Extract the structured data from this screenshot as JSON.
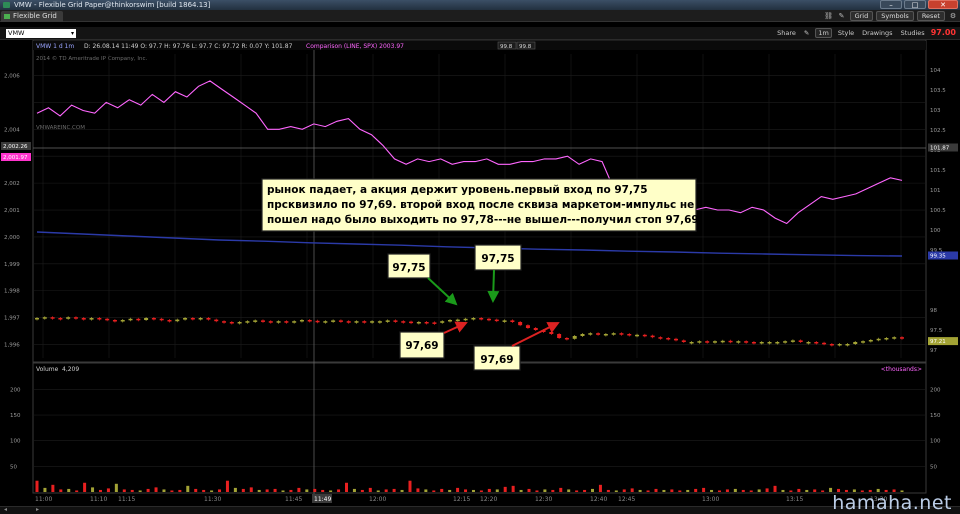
{
  "window": {
    "title": "VMW - Flexible Grid Paper@thinkorswim [build 1864.13]",
    "buttons": [
      "–",
      "□",
      "✕"
    ]
  },
  "tabbar": {
    "tab_label": "Flexible Grid",
    "grid_label": "Grid",
    "symbols_label": "Symbols",
    "reset_label": "Reset"
  },
  "chart_toolbar": {
    "symbol": "VMW",
    "share_label": "Share",
    "aggregation_label": "1m",
    "style_label": "Style",
    "drawings_label": "Drawings",
    "studies_label": "Studies",
    "last_price": "97.00"
  },
  "price_panel": {
    "header": {
      "symbol_tf": "VMW 1 d 1m",
      "ohlc": "D: 26.08.14 11:49  O: 97.7  H: 97.76  L: 97.7  C: 97.72  R: 0.07  Y: 101.87",
      "comparison": "Comparison (LINE, SPX)  2003.97",
      "box1": "99.8",
      "box2": "99.8"
    },
    "copyright": "2014 © TD Ameritrade IP Company, Inc.",
    "description": "VMWAREINC.COM",
    "left_axis_ticks": [
      "2,006",
      "2,004",
      "2,003",
      "2,002",
      "2,001",
      "2,000",
      "1,999",
      "1,998",
      "1,997",
      "1,996"
    ],
    "left_axis_badges": [
      "2,002.26",
      "2,001.97"
    ],
    "right_axis_ticks": [
      "104",
      "103.5",
      "103",
      "102.5",
      "102",
      "101.5",
      "101",
      "100.5",
      "100",
      "99.5",
      "98",
      "97.5",
      "97"
    ],
    "right_axis_badges": [
      "101.87",
      "99.35",
      "97.21"
    ]
  },
  "volume_panel": {
    "label": "Volume",
    "value": "4,209",
    "unit": "<thousands>",
    "left_axis_ticks": [
      "200",
      "150",
      "100",
      "50"
    ],
    "right_axis_ticks": [
      "200",
      "150",
      "100",
      "50"
    ]
  },
  "time_axis": {
    "labels": [
      "11:00",
      "11:10",
      "11:15",
      "11:30",
      "11:45",
      "12:00",
      "12:15",
      "12:20",
      "12:30",
      "12:40",
      "12:45",
      "13:00",
      "13:15",
      "13:30"
    ],
    "cursor_label": "11:49"
  },
  "annotations": {
    "note": "рынок падает, а акция держит уровень.первый вход по 97,75 прсквизило по 97,69. второй вход после сквиза маркетом-импульс не пошел надо было выходить по 97,78---не вышел---получил стоп 97,69",
    "note_lines": [
      "рынок падает, а акция держит уровень.первый вход по 97,75",
      "прсквизило по 97,69. второй вход после сквиза маркетом-импульс не",
      "пошел надо было выходить по 97,78---не вышел---получил стоп 97,69"
    ],
    "labels": [
      "97,75",
      "97,75",
      "97,69",
      "97,69"
    ]
  },
  "colors": {
    "comparison_line": "#ff66ff",
    "moving_average": "#2b3aa8",
    "candle_up": "#a3a335",
    "candle_down": "#e82020",
    "note_background": "#ffffc8",
    "arrow_green": "#1a9a1a",
    "arrow_red": "#dd2222"
  },
  "watermark": "hamaha.net",
  "chart_data": [
    {
      "type": "line",
      "name_ref": "price_panel.header.comparison",
      "y_axis": "left",
      "ylim": [
        1995.5,
        2006.8
      ],
      "x": [
        "11:00",
        "11:02",
        "11:04",
        "11:06",
        "11:08",
        "11:10",
        "11:12",
        "11:14",
        "11:16",
        "11:18",
        "11:20",
        "11:22",
        "11:24",
        "11:26",
        "11:28",
        "11:30",
        "11:32",
        "11:34",
        "11:36",
        "11:38",
        "11:40",
        "11:42",
        "11:44",
        "11:46",
        "11:48",
        "11:50",
        "11:52",
        "11:54",
        "11:56",
        "11:58",
        "12:00",
        "12:02",
        "12:04",
        "12:06",
        "12:08",
        "12:10",
        "12:12",
        "12:14",
        "12:16",
        "12:18",
        "12:20",
        "12:22",
        "12:24",
        "12:26",
        "12:28",
        "12:30",
        "12:32",
        "12:34",
        "12:36",
        "12:38",
        "12:40",
        "12:42",
        "12:44",
        "12:46",
        "12:48",
        "12:50",
        "12:52",
        "12:54",
        "12:56",
        "12:58",
        "13:00",
        "13:02",
        "13:04",
        "13:06",
        "13:08",
        "13:10",
        "13:12",
        "13:14",
        "13:16",
        "13:18",
        "13:20",
        "13:22",
        "13:24",
        "13:26",
        "13:28",
        "13:30"
      ],
      "values": [
        2004.6,
        2004.8,
        2004.5,
        2004.9,
        2004.7,
        2004.6,
        2005.0,
        2004.8,
        2005.1,
        2004.9,
        2005.3,
        2005.0,
        2005.4,
        2005.2,
        2005.6,
        2005.8,
        2005.5,
        2005.2,
        2004.9,
        2004.6,
        2004.0,
        2004.0,
        2004.1,
        2004.0,
        2004.2,
        2004.1,
        2004.3,
        2004.4,
        2004.0,
        2003.8,
        2003.4,
        2002.9,
        2002.7,
        2002.9,
        2002.8,
        2002.9,
        2002.7,
        2002.8,
        2002.8,
        2002.9,
        2002.7,
        2002.7,
        2002.8,
        2002.8,
        2002.9,
        2002.9,
        2003.0,
        2002.7,
        2002.9,
        2002.8,
        2001.8,
        2001.6,
        2001.5,
        2001.4,
        2001.3,
        2001.1,
        2001.0,
        2001.0,
        2001.1,
        2001.0,
        2001.0,
        2000.9,
        2001.1,
        2001.0,
        2000.7,
        2000.5,
        2000.9,
        2001.2,
        2001.5,
        2001.4,
        2001.5,
        2001.6,
        2001.8,
        2002.0,
        2002.2,
        2002.1
      ]
    },
    {
      "type": "line",
      "name_ref": "price_panel.header.symbol_tf",
      "note": "moving average",
      "y_axis": "right",
      "ylim": [
        96.8,
        104.4
      ],
      "x_range": [
        "11:00",
        "13:30"
      ],
      "values": [
        99.95,
        99.9,
        99.85,
        99.8,
        99.75,
        99.72,
        99.68,
        99.65,
        99.62,
        99.58,
        99.55,
        99.52,
        99.5,
        99.47,
        99.45,
        99.42,
        99.4,
        99.38,
        99.36,
        99.35
      ]
    },
    {
      "type": "candlestick",
      "name_ref": "price_panel.header.symbol_tf",
      "y_axis": "right",
      "ylim": [
        96.8,
        104.4
      ],
      "x_range": [
        "11:00",
        "13:30"
      ],
      "closes": [
        97.8,
        97.82,
        97.8,
        97.78,
        97.82,
        97.8,
        97.76,
        97.8,
        97.78,
        97.75,
        97.72,
        97.75,
        97.78,
        97.75,
        97.8,
        97.78,
        97.75,
        97.72,
        97.76,
        97.8,
        97.78,
        97.8,
        97.76,
        97.72,
        97.7,
        97.68,
        97.7,
        97.72,
        97.74,
        97.72,
        97.7,
        97.72,
        97.7,
        97.72,
        97.75,
        97.73,
        97.7,
        97.72,
        97.74,
        97.72,
        97.7,
        97.72,
        97.7,
        97.72,
        97.72,
        97.74,
        97.72,
        97.71,
        97.7,
        97.7,
        97.69,
        97.68,
        97.72,
        97.75,
        97.76,
        97.78,
        97.8,
        97.78,
        97.76,
        97.74,
        97.74,
        97.7,
        97.62,
        97.55,
        97.5,
        97.45,
        97.4,
        97.3,
        97.28,
        97.35,
        97.4,
        97.42,
        97.38,
        97.4,
        97.42,
        97.4,
        97.38,
        97.38,
        97.36,
        97.32,
        97.3,
        97.28,
        97.24,
        97.2,
        97.2,
        97.22,
        97.2,
        97.22,
        97.23,
        97.2,
        97.22,
        97.2,
        97.18,
        97.2,
        97.2,
        97.2,
        97.22,
        97.24,
        97.2,
        97.2,
        97.18,
        97.15,
        97.13,
        97.15,
        97.15,
        97.2,
        97.22,
        97.25,
        97.28,
        97.3,
        97.32,
        97.3
      ]
    },
    {
      "type": "bar",
      "name_ref": "volume_panel.label",
      "unit_ref": "volume_panel.unit",
      "ylim": [
        0,
        230
      ],
      "x_range": [
        "11:00",
        "13:30"
      ],
      "values": [
        22,
        8,
        14,
        5,
        6,
        3,
        18,
        9,
        4,
        7,
        16,
        5,
        4,
        3,
        6,
        9,
        5,
        3,
        4,
        12,
        6,
        4,
        3,
        5,
        22,
        8,
        6,
        9,
        4,
        5,
        6,
        3,
        4,
        8,
        5,
        6,
        4,
        3,
        5,
        18,
        6,
        4,
        8,
        3,
        5,
        6,
        4,
        22,
        7,
        5,
        3,
        6,
        4,
        8,
        5,
        4,
        3,
        6,
        5,
        10,
        12,
        4,
        6,
        3,
        5,
        4,
        8,
        5,
        3,
        4,
        6,
        14,
        4,
        3,
        5,
        7,
        4,
        3,
        6,
        4,
        5,
        3,
        4,
        6,
        8,
        4,
        3,
        5,
        6,
        4,
        3,
        5,
        7,
        12,
        4,
        3,
        6,
        4,
        5,
        3,
        8,
        6,
        4,
        5,
        3,
        4,
        6,
        4,
        5,
        3
      ]
    }
  ]
}
